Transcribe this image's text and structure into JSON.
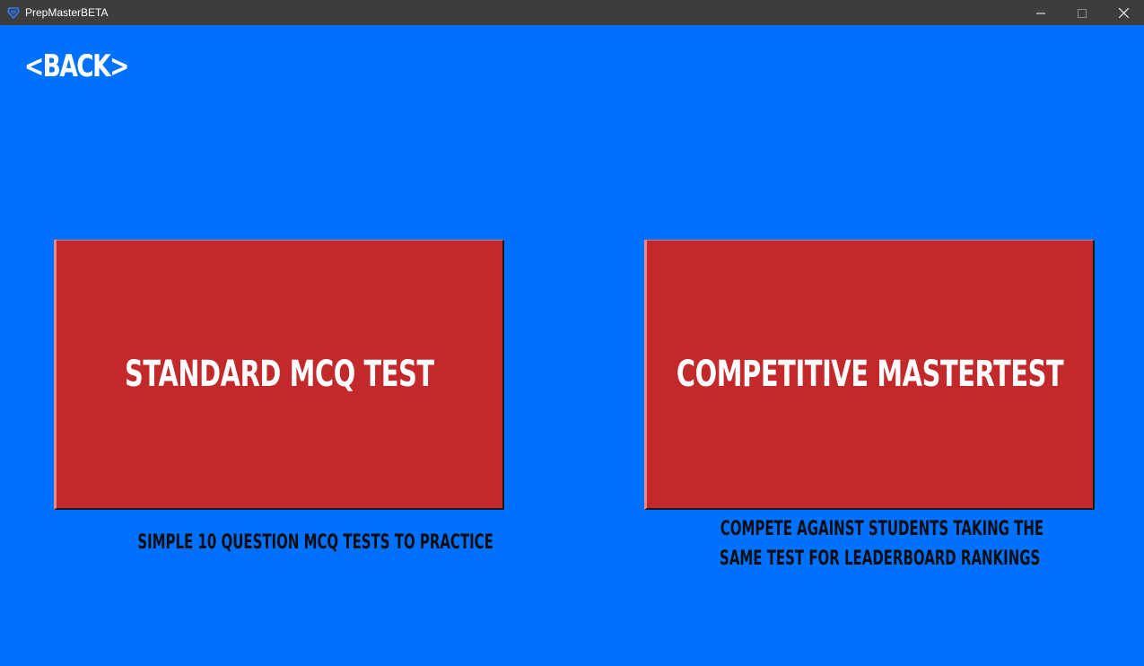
{
  "window": {
    "title": "PrepMasterBETA",
    "controls": {
      "minimize": "minimize-icon",
      "maximize": "maximize-icon",
      "close": "close-icon"
    }
  },
  "nav": {
    "back_label": "<BACK>"
  },
  "modes": [
    {
      "label": "STANDARD MCQ TEST",
      "description": [
        "SIMPLE 10 QUESTION MCQ TESTS TO PRACTICE"
      ]
    },
    {
      "label": "COMPETITIVE MASTERTEST",
      "description": [
        "COMPETE AGAINST STUDENTS TAKING THE",
        "SAME TEST FOR LEADERBOARD RANKINGS"
      ]
    }
  ],
  "colors": {
    "background": "#0070ff",
    "card": "#c3282a",
    "titlebar": "#3d3d3d",
    "label_text": "#ffffff",
    "description_text": "#0d0d0d"
  }
}
